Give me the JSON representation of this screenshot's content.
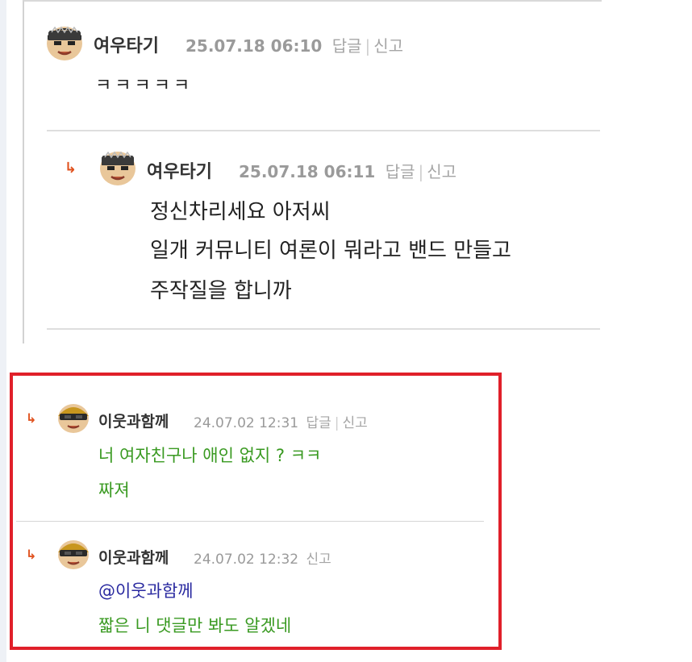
{
  "comments_top": [
    {
      "nickname": "여우타기",
      "timestamp": "25.07.18 06:10",
      "reply_label": "답글",
      "report_label": "신고",
      "separator": "|",
      "body": "ㅋㅋㅋㅋㅋ"
    },
    {
      "nickname": "여우타기",
      "timestamp": "25.07.18 06:11",
      "reply_label": "답글",
      "report_label": "신고",
      "separator": "|",
      "body_lines": [
        "정신차리세요 아저씨",
        "일개 커뮤니티 여론이 뭐라고 밴드 만들고",
        "주작질을 합니까"
      ]
    }
  ],
  "comments_highlighted": [
    {
      "nickname": "이웃과함께",
      "timestamp": "24.07.02 12:31",
      "reply_label": "답글",
      "report_label": "신고",
      "separator": "|",
      "body_lines": [
        "너 여자친구나 애인 없지 ? ㅋㅋ",
        "짜져"
      ]
    },
    {
      "nickname": "이웃과함께",
      "timestamp": "24.07.02 12:32",
      "report_label": "신고",
      "mention": "@이웃과함께",
      "body_lines": [
        "짧은 니 댓글만 봐도 알겠네"
      ]
    }
  ],
  "icons": {
    "reply_arrow": "reply-arrow-icon",
    "avatar_fox": "avatar-icon",
    "avatar_helmet": "avatar-icon"
  },
  "colors": {
    "highlight_border": "#e0202a",
    "reply_arrow": "#e0521f",
    "green_text": "#3a9a22",
    "mention_text": "#2a2aa0"
  }
}
